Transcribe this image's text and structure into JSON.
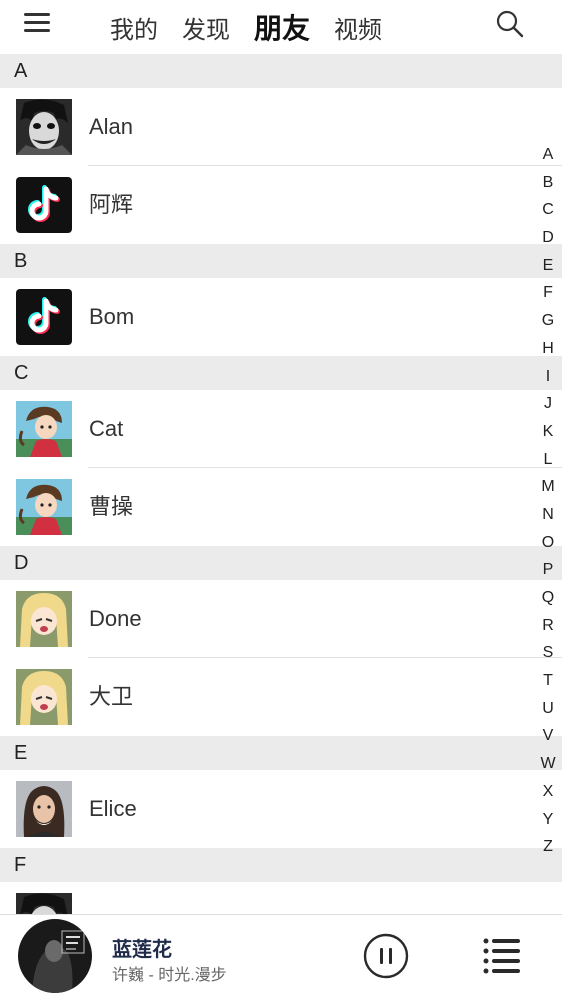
{
  "nav": {
    "tabs": [
      {
        "label": "我的"
      },
      {
        "label": "发现"
      },
      {
        "label": "朋友"
      },
      {
        "label": "视频"
      }
    ],
    "active_tab": "朋友"
  },
  "contacts": [
    {
      "letter": "A",
      "items": [
        {
          "name": "Alan",
          "avatar": "joker-avatar"
        },
        {
          "name": "阿辉",
          "avatar": "tiktok-logo-avatar"
        }
      ]
    },
    {
      "letter": "B",
      "items": [
        {
          "name": "Bom",
          "avatar": "tiktok-logo-avatar"
        }
      ]
    },
    {
      "letter": "C",
      "items": [
        {
          "name": "Cat",
          "avatar": "anime-girl-avatar"
        },
        {
          "name": "曹操",
          "avatar": "anime-girl-avatar"
        }
      ]
    },
    {
      "letter": "D",
      "items": [
        {
          "name": "Done",
          "avatar": "anime-blonde-avatar"
        },
        {
          "name": "大卫",
          "avatar": "anime-blonde-avatar"
        }
      ]
    },
    {
      "letter": "E",
      "items": [
        {
          "name": "Elice",
          "avatar": "woman-photo-avatar"
        }
      ]
    },
    {
      "letter": "F",
      "items": []
    }
  ],
  "alphabet_index": [
    "A",
    "B",
    "C",
    "D",
    "E",
    "F",
    "G",
    "H",
    "I",
    "J",
    "K",
    "L",
    "M",
    "N",
    "O",
    "P",
    "Q",
    "R",
    "S",
    "T",
    "U",
    "V",
    "W",
    "X",
    "Y",
    "Z"
  ],
  "player": {
    "title": "蓝莲花",
    "subtitle": "许巍 - 时光.漫步",
    "cover_art": "album-cover-xu-wei"
  },
  "colors": {
    "section_bg": "#ebebeb",
    "title_dark": "#1f2b49",
    "tiktok_cyan": "#25f4ee",
    "tiktok_red": "#fe2c55"
  }
}
